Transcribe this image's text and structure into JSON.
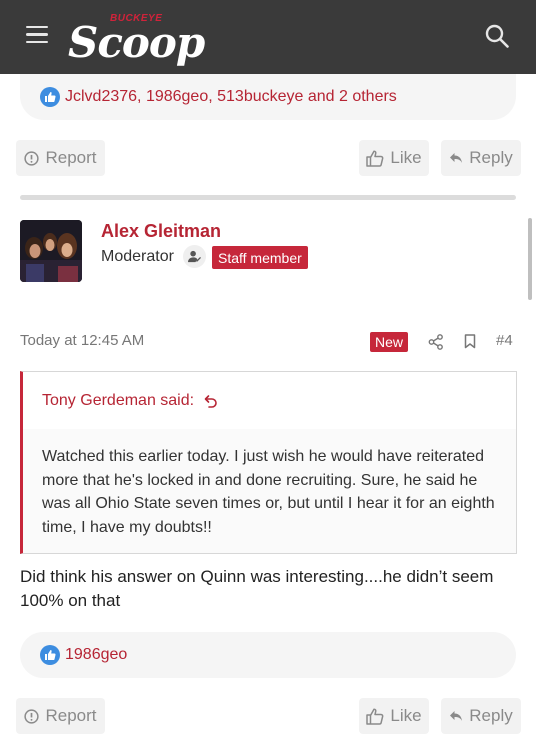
{
  "header": {
    "logo_small": "BUCKEYE",
    "logo_main": "Scoop"
  },
  "prev_post": {
    "reactions": "Jclvd2376, 1986geo, 513buckeye and 2 others",
    "report_label": "Report",
    "like_label": "Like",
    "reply_label": "Reply"
  },
  "post": {
    "author": "Alex Gleitman",
    "role": "Moderator",
    "staff_badge": "Staff member",
    "timestamp": "Today at 12:45 AM",
    "new_badge": "New",
    "post_number": "#4",
    "quote": {
      "author": "Tony Gerdeman said:",
      "text": "Watched this earlier today. I just wish he would have reiterated more that he's locked in and done recruiting. Sure, he said he was all Ohio State seven times or, but until I hear it for an eighth time, I have my doubts!!"
    },
    "message": "Did think his answer on Quinn was interesting....he didn’t seem 100% on that",
    "reactions": "1986geo",
    "report_label": "Report",
    "like_label": "Like",
    "reply_label": "Reply"
  },
  "colors": {
    "header_bg": "#3a3a3a",
    "accent": "#b62534",
    "badge": "#c6273a",
    "like_blue": "#3d8de0"
  }
}
